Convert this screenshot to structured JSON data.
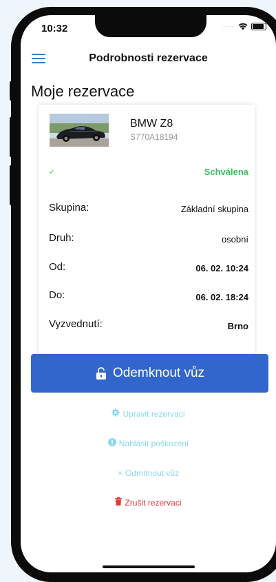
{
  "status_bar": {
    "time": "10:32"
  },
  "nav": {
    "title": "Podrobnosti rezervace"
  },
  "page": {
    "title": "Moje rezervace"
  },
  "reservation": {
    "car_name": "BMW Z8",
    "car_plate": "S770A18194",
    "status": "Schválena",
    "rows": [
      {
        "label": "Skupina:",
        "value": "Základní skupina"
      },
      {
        "label": "Druh:",
        "value": "osobní"
      },
      {
        "label": "Od:",
        "value": "06. 02. 10:24"
      },
      {
        "label": "Do:",
        "value": "06. 02. 18:24"
      },
      {
        "label": "Vyzvednutí:",
        "value": "Brno"
      }
    ]
  },
  "actions": {
    "unlock": "Odemknout vůz",
    "edit": "Upravit rezervaci",
    "report_damage": "Nahlásit poškození",
    "decline": "Odmítnout vůz",
    "cancel": "Zrušit rezervaci"
  },
  "colors": {
    "accent": "#3366cc",
    "status_ok": "#38c15b",
    "light_action": "#8ad8ee",
    "danger": "#e53935"
  }
}
